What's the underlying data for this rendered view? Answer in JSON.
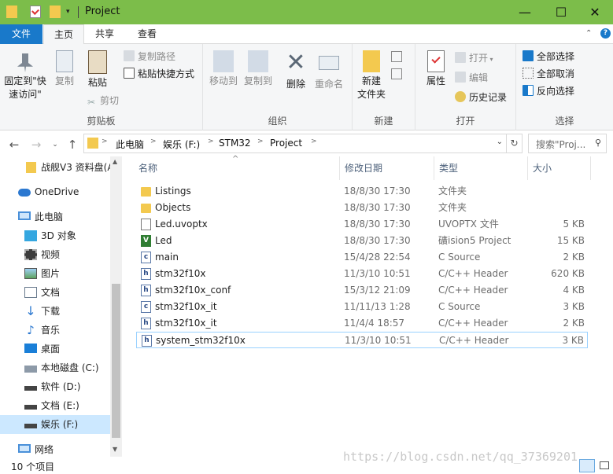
{
  "window": {
    "title": "Project",
    "minimize_glyph": "—",
    "maximize_glyph": "☐",
    "close_glyph": "✕"
  },
  "ribbon_tabs": [
    "文件",
    "主页",
    "共享",
    "查看"
  ],
  "ribbon": {
    "clipboard": {
      "pin": "固定到\"快\n速访问\"",
      "copy": "复制",
      "paste": "粘贴",
      "copy_path": "复制路径",
      "paste_shortcut": "粘贴快捷方式",
      "cut": "剪切",
      "group_label": "剪贴板"
    },
    "organize": {
      "move_to": "移动到",
      "copy_to": "复制到",
      "delete": "删除",
      "rename": "重命名",
      "group_label": "组织"
    },
    "new": {
      "new_folder": "新建\n文件夹",
      "group_label": "新建"
    },
    "open": {
      "properties": "属性",
      "open": "打开",
      "edit": "编辑",
      "history": "历史记录",
      "group_label": "打开"
    },
    "select": {
      "select_all": "全部选择",
      "select_none": "全部取消",
      "invert": "反向选择",
      "group_label": "选择"
    }
  },
  "address": {
    "crumbs": [
      "此电脑",
      "娱乐 (F:)",
      "STM32",
      "Project"
    ],
    "search_placeholder": "搜索\"Proj..."
  },
  "nav_pane": [
    {
      "label": "战舰V3 资料盘(A",
      "icon": "folder-icon"
    },
    {
      "label": "OneDrive",
      "icon": "cloud-icon"
    },
    {
      "label": "此电脑",
      "icon": "computer-icon"
    },
    {
      "label": "3D 对象",
      "icon": "cube-icon"
    },
    {
      "label": "视频",
      "icon": "video-icon"
    },
    {
      "label": "图片",
      "icon": "picture-icon"
    },
    {
      "label": "文档",
      "icon": "document-icon"
    },
    {
      "label": "下载",
      "icon": "download-icon"
    },
    {
      "label": "音乐",
      "icon": "music-icon"
    },
    {
      "label": "桌面",
      "icon": "desktop-icon"
    },
    {
      "label": "本地磁盘 (C:)",
      "icon": "drive-icon"
    },
    {
      "label": "软件 (D:)",
      "icon": "drive-icon"
    },
    {
      "label": "文档 (E:)",
      "icon": "drive-icon"
    },
    {
      "label": "娱乐 (F:)",
      "icon": "drive-icon"
    },
    {
      "label": "网络",
      "icon": "network-icon"
    }
  ],
  "columns": [
    "名称",
    "修改日期",
    "类型",
    "大小"
  ],
  "files": [
    {
      "name": "Listings",
      "date": "18/8/30 17:30",
      "type": "文件夹",
      "size": "",
      "icon": "folder"
    },
    {
      "name": "Objects",
      "date": "18/8/30 17:30",
      "type": "文件夹",
      "size": "",
      "icon": "folder"
    },
    {
      "name": "Led.uvoptx",
      "date": "18/8/30 17:30",
      "type": "UVOPTX 文件",
      "size": "5 KB",
      "icon": "doc"
    },
    {
      "name": "Led",
      "date": "18/8/30 17:30",
      "type": "礦ision5 Project",
      "size": "15 KB",
      "icon": "project"
    },
    {
      "name": "main",
      "date": "15/4/28 22:54",
      "type": "C Source",
      "size": "2 KB",
      "icon": "c"
    },
    {
      "name": "stm32f10x",
      "date": "11/3/10 10:51",
      "type": "C/C++ Header",
      "size": "620 KB",
      "icon": "h"
    },
    {
      "name": "stm32f10x_conf",
      "date": "15/3/12 21:09",
      "type": "C/C++ Header",
      "size": "4 KB",
      "icon": "h"
    },
    {
      "name": "stm32f10x_it",
      "date": "11/11/13 1:28",
      "type": "C Source",
      "size": "3 KB",
      "icon": "c"
    },
    {
      "name": "stm32f10x_it",
      "date": "11/4/4 18:57",
      "type": "C/C++ Header",
      "size": "2 KB",
      "icon": "h"
    },
    {
      "name": "system_stm32f10x",
      "date": "11/3/10 10:51",
      "type": "C/C++ Header",
      "size": "3 KB",
      "icon": "h"
    }
  ],
  "status": {
    "count": "10 个项目",
    "watermark": "https://blog.csdn.net/qq_37369201"
  }
}
